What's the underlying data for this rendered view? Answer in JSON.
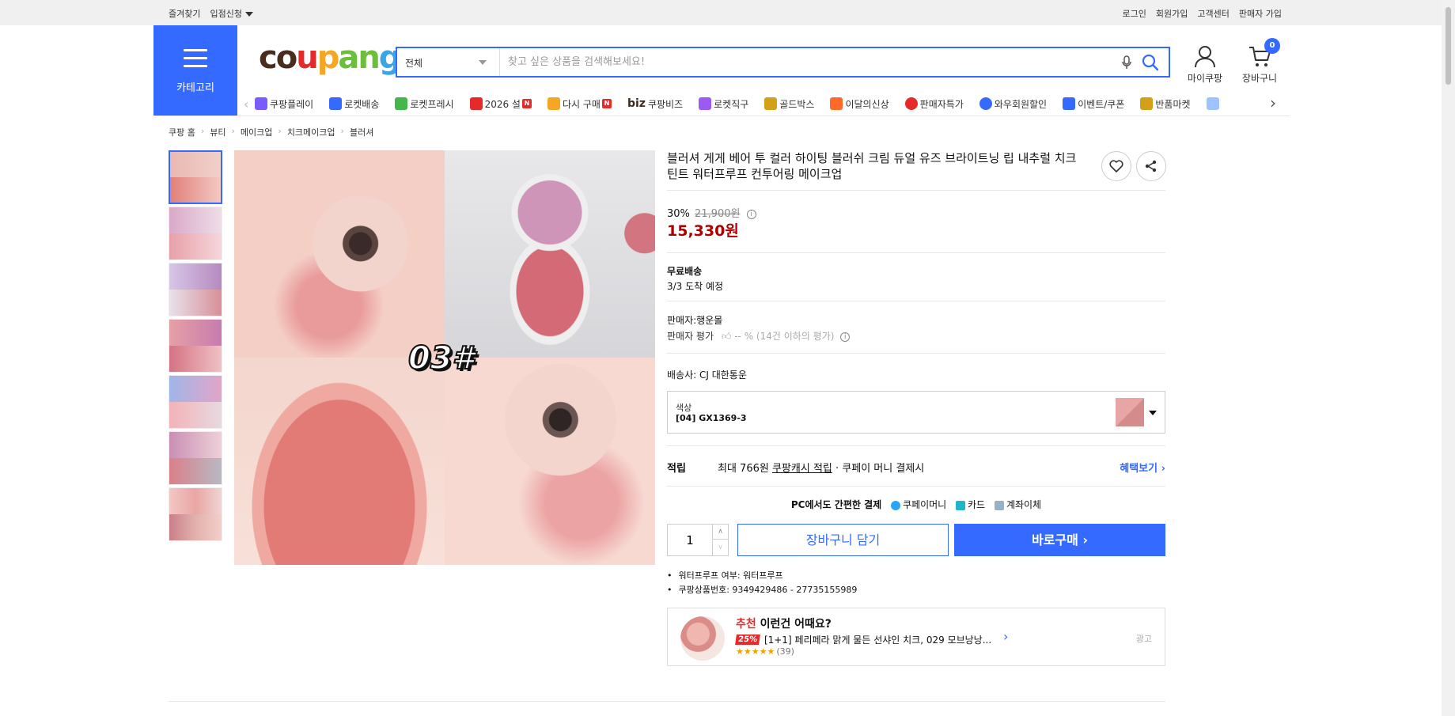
{
  "topbar": {
    "left": [
      "즐겨찾기",
      "입점신청"
    ],
    "right": [
      "로그인",
      "회원가입",
      "고객센터",
      "판매자 가입"
    ]
  },
  "header": {
    "category_label": "카테고리",
    "logo": {
      "parts": [
        "co",
        "u",
        "p",
        "an",
        "g"
      ]
    },
    "search_category": "전체",
    "search_placeholder": "찾고 싶은 상품을 검색해보세요!",
    "mycoupang": "마이쿠팡",
    "cart": "장바구니",
    "cart_count": "0"
  },
  "catnav": [
    {
      "label": "쿠팡플레이",
      "icon": "play-icon",
      "color": "#7b5cff"
    },
    {
      "label": "로켓배송",
      "icon": "rocket-icon",
      "color": "#346aff"
    },
    {
      "label": "로켓프레시",
      "icon": "rocket-fresh-icon",
      "color": "#45b649"
    },
    {
      "label": "2026 설",
      "icon": "gift-icon",
      "color": "#e62a2a",
      "badge": "N"
    },
    {
      "label": "다시 구매",
      "icon": "reorder-icon",
      "color": "#f5a623",
      "badge": "N"
    },
    {
      "label": "쿠팡비즈",
      "icon": "biz-icon",
      "color": "#3b2a1a",
      "prefix": "biz"
    },
    {
      "label": "로켓직구",
      "icon": "global-icon",
      "color": "#9b59f5"
    },
    {
      "label": "골드박스",
      "icon": "goldbox-icon",
      "color": "#d4a017"
    },
    {
      "label": "이달의신상",
      "icon": "new-icon",
      "color": "#ff6a2a"
    },
    {
      "label": "판매자특가",
      "icon": "sale-icon",
      "color": "#e62a2a"
    },
    {
      "label": "와우회원할인",
      "icon": "wow-icon",
      "color": "#346aff"
    },
    {
      "label": "이벤트/쿠폰",
      "icon": "coupon-icon",
      "color": "#346aff"
    },
    {
      "label": "반품마켓",
      "icon": "market-icon",
      "color": "#d4a017"
    }
  ],
  "breadcrumb": [
    "쿠팡 홈",
    "뷰티",
    "메이크업",
    "치크메이크업",
    "블러셔"
  ],
  "product": {
    "shade_label": "03#",
    "title": "블러셔 게게 베어 투 컬러 하이팅 블러쉬 크림 듀얼 유즈 브라이트닝 립 내추럴 치크 틴트 워터프루프 컨투어링 메이크업",
    "discount": "30%",
    "original_price": "21,900원",
    "price": "15,330원",
    "shipping_title": "무료배송",
    "shipping_date": "3/3 도착 예정",
    "seller": "판매자:행운몰",
    "seller_rating_label": "판매자 평가",
    "seller_rating_value": "-- % (14건 이하의 평가)",
    "carrier": "배송사:  CJ 대한통운",
    "option_label": "색상",
    "option_value": "[04] GX1369-3",
    "reward_label": "적립",
    "reward_amount": "최대 766원",
    "reward_link": "쿠팡캐시 적립",
    "reward_suffix": " · 쿠페이 머니 결제시",
    "reward_more": "혜택보기 ›",
    "pay_title": "PC에서도 간편한 결제",
    "pay_methods": [
      "쿠페이머니",
      "카드",
      "계좌이체"
    ],
    "quantity": "1",
    "add_to_cart": "장바구니 담기",
    "buy_now": "바로구매 ›",
    "specs": [
      "워터프루프 여부: 워터프루프",
      "쿠팡상품번호: 9349429486 - 27735155989"
    ]
  },
  "recommend": {
    "head_red": "추천",
    "head": " 이런건 어때요?",
    "discount": "25%",
    "item": "[1+1] 페리페라 맑게 물든 선샤인 치크, 029 모브낭낭...",
    "stars": "★★★★★",
    "count": "(39)",
    "ad": "광고"
  },
  "colors": {
    "accent": "#346aff",
    "price": "#ae0000",
    "badge": "#e62a2a"
  }
}
